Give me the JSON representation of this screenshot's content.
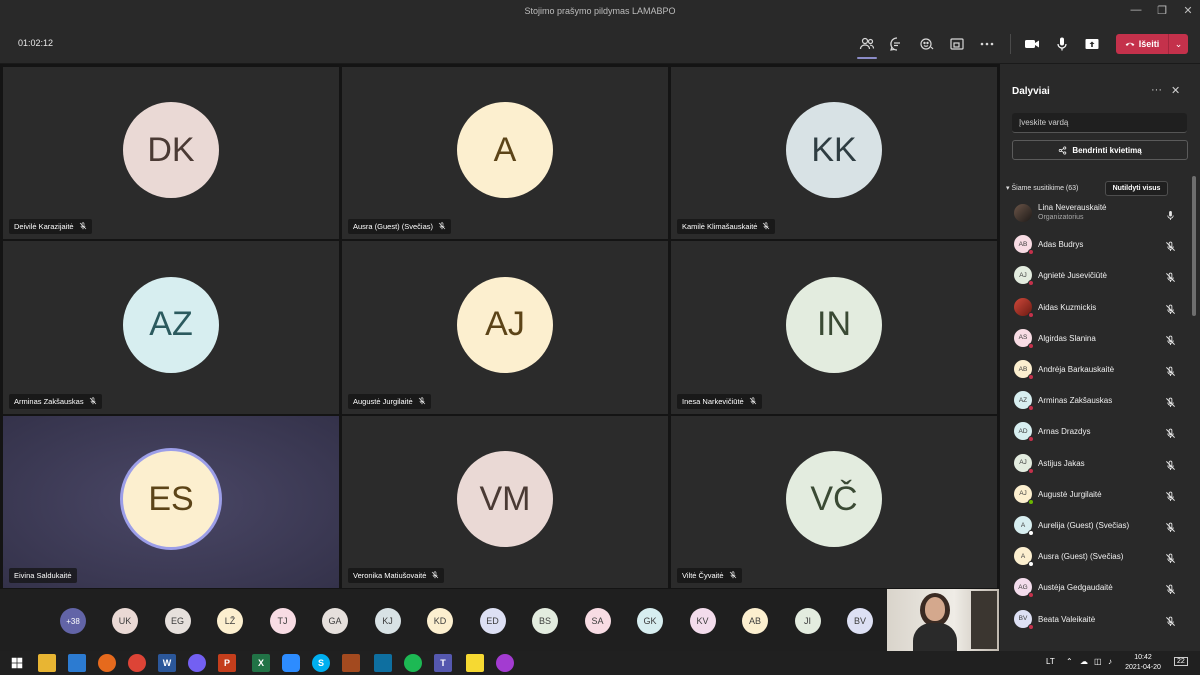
{
  "window": {
    "title": "Stojimo prašymo pildymas LAMABPO",
    "min": "—",
    "max": "❐",
    "close": "✕"
  },
  "toolbar": {
    "timer": "01:02:12",
    "leave_label": "Išeiti",
    "leave_dropdown": "⌄"
  },
  "tiles": [
    {
      "initials": "DK",
      "name": "Deivilė Karazijaitė",
      "color": "#ead9d5",
      "text_color": "#4a3a34"
    },
    {
      "initials": "A",
      "name": "Ausra (Guest) (Svečias)",
      "color": "#fcefcf",
      "text_color": "#5c4418"
    },
    {
      "initials": "KK",
      "name": "Kamilė Klimašauskaitė",
      "color": "#d8e2e5",
      "text_color": "#2f3d42"
    },
    {
      "initials": "AZ",
      "name": "Arminas Zakšauskas",
      "color": "#d7eef0",
      "text_color": "#2b5a5e"
    },
    {
      "initials": "AJ",
      "name": "Augustė Jurgilaitė",
      "color": "#fcefcf",
      "text_color": "#5c4418"
    },
    {
      "initials": "IN",
      "name": "Inesa Narkevičiūtė",
      "color": "#e3ecdf",
      "text_color": "#3a4a34"
    },
    {
      "initials": "ES",
      "name": "Eivina Saldukaitė",
      "color": "#fcefcf",
      "text_color": "#5c4418"
    },
    {
      "initials": "VM",
      "name": "Veronika Matiušovaitė",
      "color": "#ead9d5",
      "text_color": "#4a3a34"
    },
    {
      "initials": "VČ",
      "name": "Viltė Čyvaitė",
      "color": "#e3ecdf",
      "text_color": "#3a4a34"
    }
  ],
  "strip": {
    "more_label": "+38",
    "avatars": [
      {
        "initials": "UK",
        "color": "#ead9d5"
      },
      {
        "initials": "EG",
        "color": "#e6e0dc"
      },
      {
        "initials": "LŽ",
        "color": "#fcefcf"
      },
      {
        "initials": "TJ",
        "color": "#f8dce4"
      },
      {
        "initials": "GA",
        "color": "#e6e0dc"
      },
      {
        "initials": "KJ",
        "color": "#d8e2e5"
      },
      {
        "initials": "KD",
        "color": "#fcefcf"
      },
      {
        "initials": "ED",
        "color": "#dde0f4"
      },
      {
        "initials": "BS",
        "color": "#e3ecdf"
      },
      {
        "initials": "SA",
        "color": "#f8dce4"
      },
      {
        "initials": "GK",
        "color": "#d7eef0"
      },
      {
        "initials": "KV",
        "color": "#f3dcec"
      },
      {
        "initials": "AB",
        "color": "#fcefcf"
      },
      {
        "initials": "JI",
        "color": "#e3ecdf"
      },
      {
        "initials": "BV",
        "color": "#dde0f4"
      }
    ]
  },
  "panel": {
    "title": "Dalyviai",
    "more": "···",
    "close": "✕",
    "search_placeholder": "Įveskite vardą",
    "share_label": "Bendrinti kvietimą",
    "section_label": "Šiame susitikime (63)",
    "mute_all_label": "Nutildyti visus",
    "participants": [
      {
        "initials": "LN",
        "name": "Lina Neverauskaitė",
        "role": "Organizatorius",
        "color": "#3a3a3a",
        "dot": "",
        "photo": true
      },
      {
        "initials": "AB",
        "name": "Adas Budrys",
        "role": "",
        "color": "#f8dce4",
        "dot": "#c4314b"
      },
      {
        "initials": "AJ",
        "name": "Agnietė Jusevičiūtė",
        "role": "",
        "color": "#e3ecdf",
        "dot": "#c4314b"
      },
      {
        "initials": "AK",
        "name": "Aidas Kuzmickis",
        "role": "",
        "color": "#c0392b",
        "dot": "#c4314b",
        "photo": true
      },
      {
        "initials": "AS",
        "name": "Algirdas Slanina",
        "role": "",
        "color": "#f8dce4",
        "dot": "#c4314b"
      },
      {
        "initials": "AB",
        "name": "Andrėja Barkauskaitė",
        "role": "",
        "color": "#fcefcf",
        "dot": "#c4314b"
      },
      {
        "initials": "AZ",
        "name": "Arminas Zakšauskas",
        "role": "",
        "color": "#d7eef0",
        "dot": "#c4314b"
      },
      {
        "initials": "AD",
        "name": "Arnas Drazdys",
        "role": "",
        "color": "#d7eef0",
        "dot": "#c4314b"
      },
      {
        "initials": "AJ",
        "name": "Astijus Jakas",
        "role": "",
        "color": "#e3ecdf",
        "dot": "#c4314b"
      },
      {
        "initials": "AJ",
        "name": "Augustė Jurgilaitė",
        "role": "",
        "color": "#fcefcf",
        "dot": "#6bb700"
      },
      {
        "initials": "A",
        "name": "Aurelija (Guest) (Svečias)",
        "role": "",
        "color": "#d7eef0",
        "dot": "#ffffff"
      },
      {
        "initials": "A",
        "name": "Ausra (Guest) (Svečias)",
        "role": "",
        "color": "#fcefcf",
        "dot": "#ffffff"
      },
      {
        "initials": "AG",
        "name": "Austėja Gedgaudaitė",
        "role": "",
        "color": "#f3dcec",
        "dot": "#c4314b"
      },
      {
        "initials": "BV",
        "name": "Beata Valeikaitė",
        "role": "",
        "color": "#dde0f4",
        "dot": "#c4314b"
      }
    ]
  },
  "taskbar": {
    "lang": "LT",
    "time": "10:42",
    "date": "2021-04-20",
    "notif": "22"
  }
}
